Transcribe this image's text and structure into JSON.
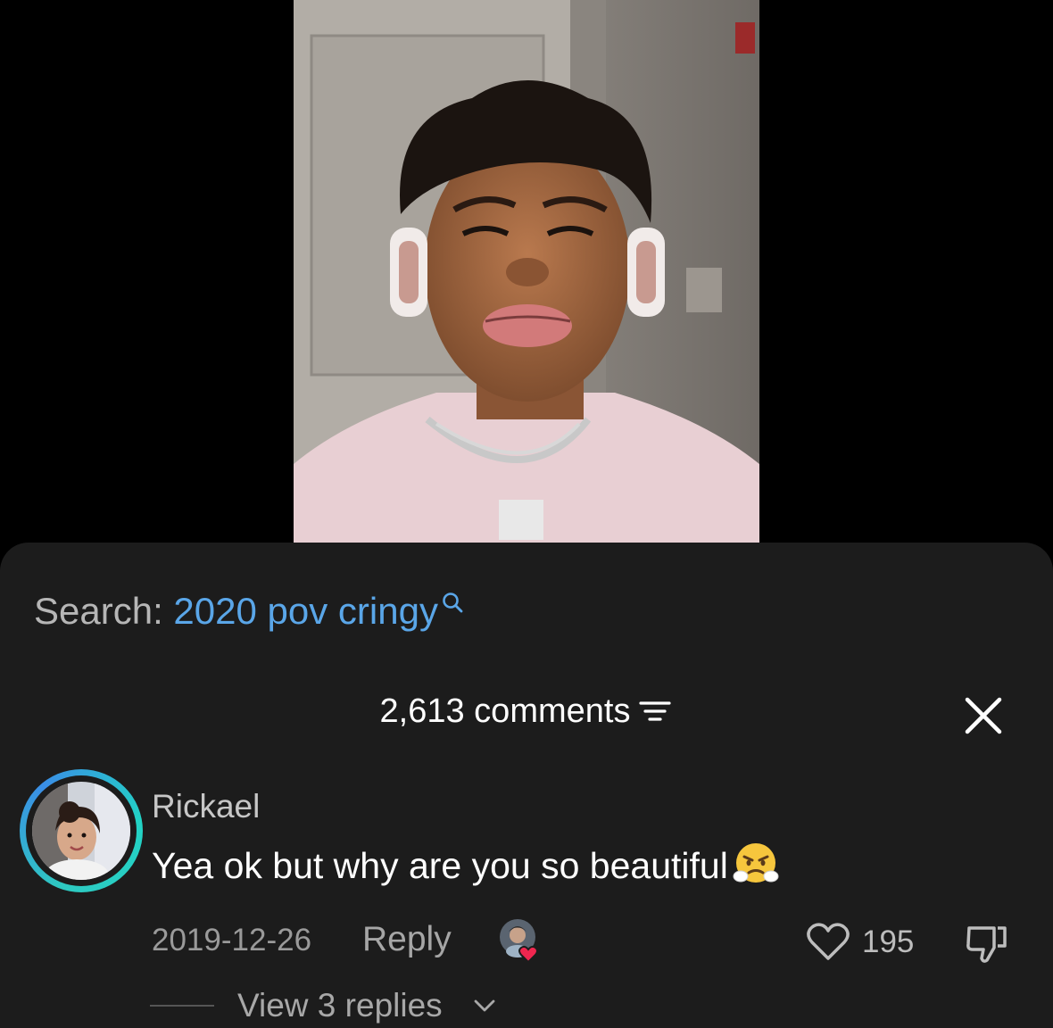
{
  "video": {
    "description_icon": "video-frame"
  },
  "search": {
    "prefix": "Search: ",
    "query": "2020 pov cringy",
    "icon": "search-icon"
  },
  "comments_header": {
    "count_label": "2,613 comments",
    "filter_icon": "filter-icon",
    "close_icon": "close-icon"
  },
  "comment": {
    "username": "Rickael",
    "text": "Yea ok but why are you so beautiful",
    "emoji": "angry-face-emoji",
    "date": "2019-12-26",
    "reply_label": "Reply",
    "creator_liked_icon": "creator-liked-icon",
    "like_icon": "heart-icon",
    "like_count": "195",
    "dislike_icon": "thumbs-down-icon",
    "view_replies_label": "View 3 replies",
    "view_replies_icon": "chevron-down-icon"
  },
  "colors": {
    "background": "#000000",
    "sheet": "#1c1c1c",
    "search_link": "#5aa6e8",
    "avatar_ring": "#2ec9c1"
  }
}
